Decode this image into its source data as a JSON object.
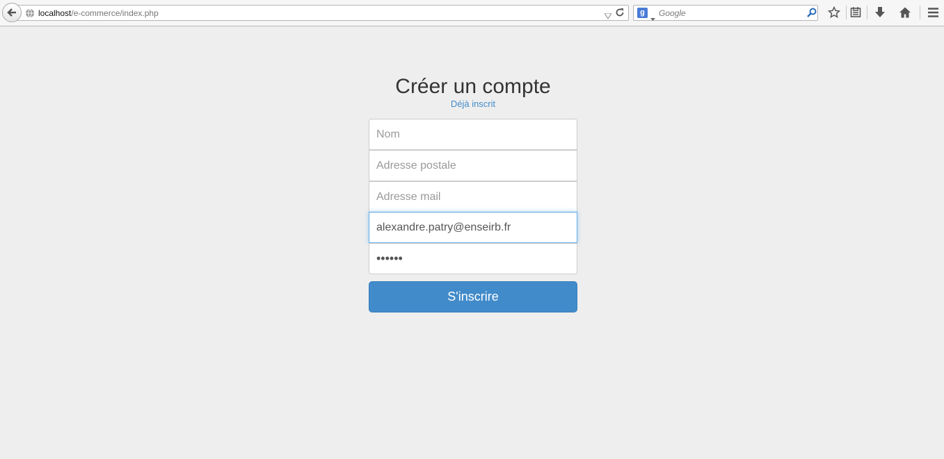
{
  "browser": {
    "url_host": "localhost",
    "url_path": "/e-commerce/index.php",
    "search_engine_icon": "g",
    "search_placeholder": "Google",
    "icons": [
      "back-arrow-icon",
      "globe-icon",
      "dropdown-icon",
      "reload-icon",
      "google-icon",
      "search-icon",
      "star-icon",
      "reading-list-icon",
      "download-icon",
      "home-icon",
      "menu-icon"
    ]
  },
  "form": {
    "title": "Créer un compte",
    "signin_link": "Déjà inscrit",
    "name_placeholder": "Nom",
    "address_placeholder": "Adresse postale",
    "email_placeholder": "Adresse mail",
    "email_value": "alexandre.patry@enseirb.fr",
    "password_value": "aaaaaa",
    "submit_label": "S'inscrire"
  },
  "colors": {
    "background": "#eeeeee",
    "primary": "#428bca",
    "focus_border": "#66afe9"
  }
}
